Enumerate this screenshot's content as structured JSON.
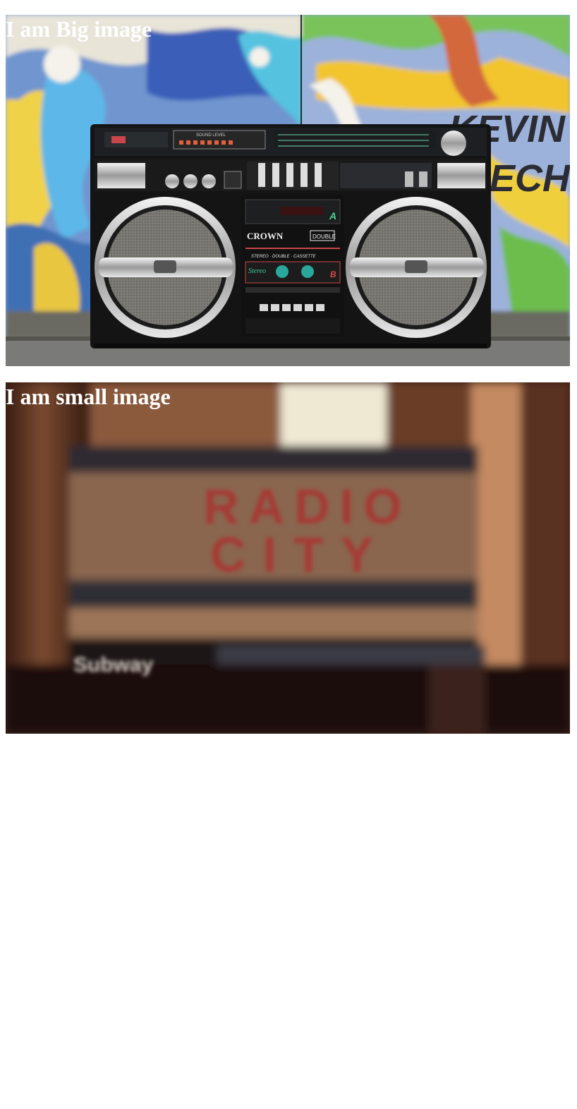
{
  "panels": [
    {
      "heading": "I am Big image",
      "device": {
        "brand": "CROWN",
        "badge": "DOUBLE",
        "band": "STEREO · DOUBLE · CASSETTE",
        "deck_label": "Stereo",
        "deck_a": "A",
        "deck_b": "B",
        "meter_label": "SOUND LEVEL"
      },
      "wall_text": [
        "KEVIN",
        "ECH"
      ]
    },
    {
      "heading": "I am small image",
      "sign": {
        "line1": "RADIO",
        "line2": "CITY",
        "lower": "Subway"
      }
    }
  ],
  "colors": {
    "heading": "#ffffff",
    "background": "#ffffff"
  }
}
